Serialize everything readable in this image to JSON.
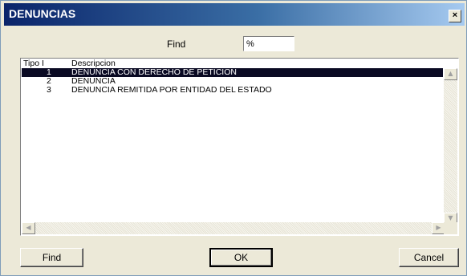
{
  "window": {
    "title": "DENUNCIAS",
    "close_glyph": "×"
  },
  "search": {
    "label": "Find",
    "value": "%"
  },
  "list": {
    "columns": [
      "Tipo I",
      "Descripcion"
    ],
    "rows": [
      {
        "tipo": "1",
        "descripcion": "DENUNCIA CON DERECHO DE PETICION",
        "selected": true
      },
      {
        "tipo": "2",
        "descripcion": "DENUNCIA",
        "selected": false
      },
      {
        "tipo": "3",
        "descripcion": "DENUNCIA REMITIDA POR ENTIDAD DEL ESTADO",
        "selected": false
      }
    ]
  },
  "buttons": {
    "find": "Find",
    "ok": "OK",
    "cancel": "Cancel"
  },
  "icons": {
    "scroll_up": "scroll-up-arrow",
    "scroll_down": "scroll-down-arrow",
    "scroll_left": "scroll-left-arrow",
    "scroll_right": "scroll-right-arrow"
  },
  "colors": {
    "title_start": "#0a246a",
    "title_end": "#a6caf0",
    "selection": "#0a0a23",
    "face": "#ECE9D8"
  }
}
